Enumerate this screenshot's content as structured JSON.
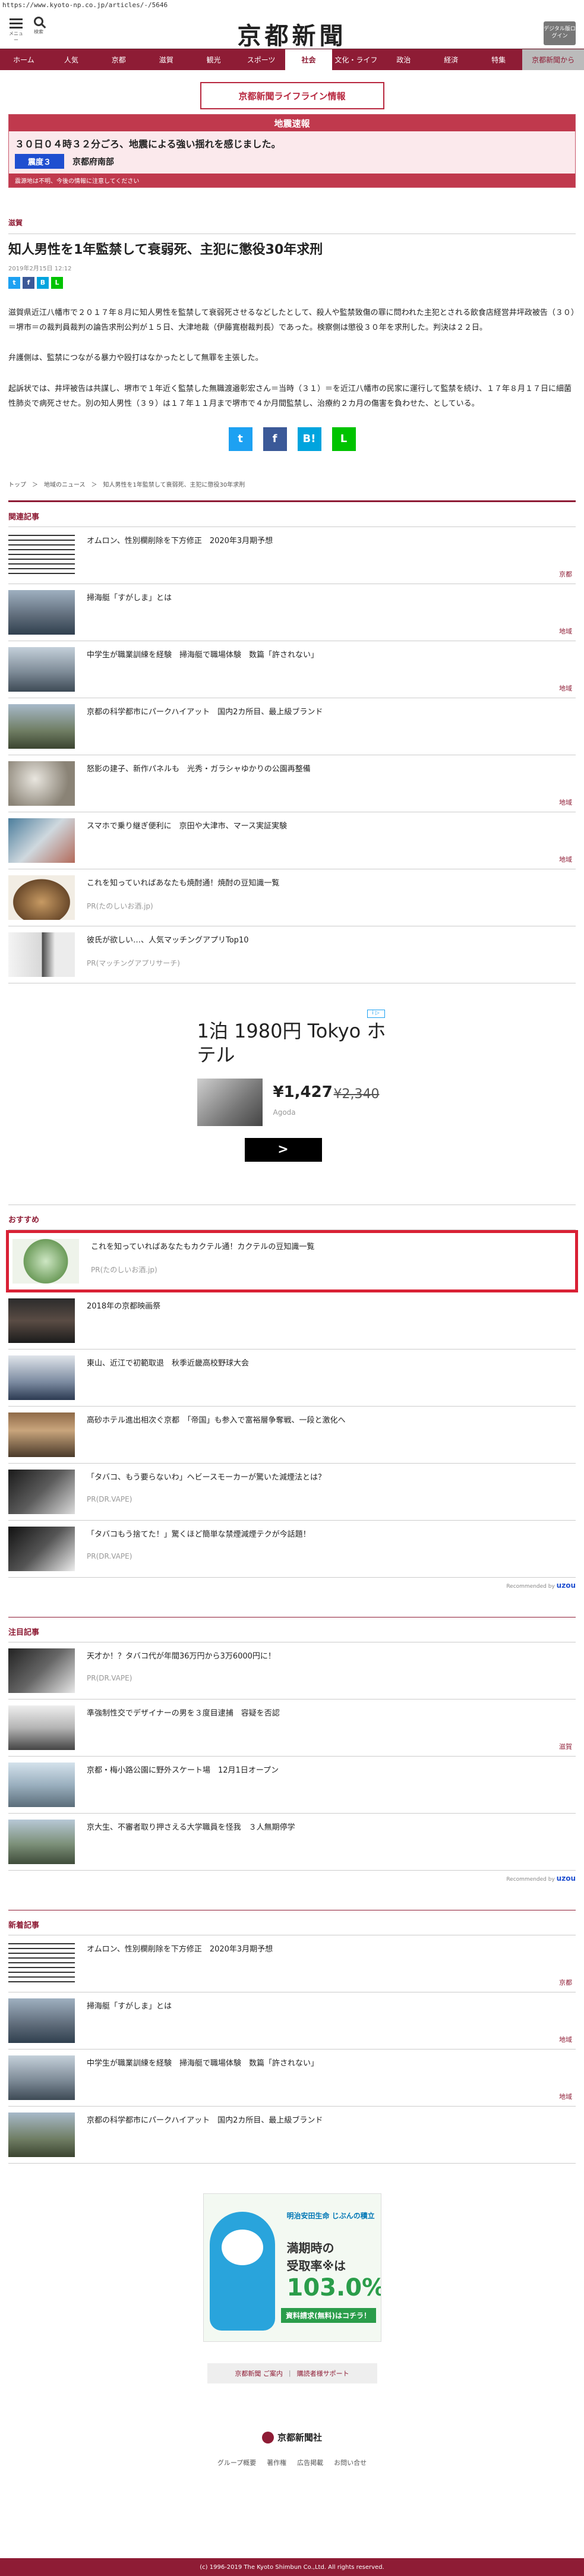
{
  "browser": {
    "url": "https://www.kyoto-np.co.jp/articles/-/5646"
  },
  "header": {
    "menu_label": "メニュー",
    "search_label": "検索",
    "logo": "京都新聞",
    "digital_label": "デジタル版ログイン"
  },
  "nav": {
    "items": [
      "ホーム",
      "人気",
      "京都",
      "滋賀",
      "観光",
      "スポーツ",
      "社会",
      "文化・ライフ",
      "政治",
      "経済",
      "特集"
    ],
    "active": "社会",
    "shinbun": "京都新聞から"
  },
  "lifeline": {
    "label": "京都新聞ライフライン情報"
  },
  "quake": {
    "header": "地震速報",
    "title": "３０日０４時３２分ごろ、地震による強い揺れを感じました。",
    "intensity": "震度３",
    "place": "京都府南部",
    "note": "震源地は不明、今後の情報に注意してください"
  },
  "article": {
    "category": "滋賀",
    "title": "知人男性を1年監禁して衰弱死、主犯に懲役30年求刑",
    "date": "2019年2月15日 12:12",
    "paragraphs": [
      "滋賀県近江八幡市で２０１７年８月に知人男性を監禁して衰弱死させるなどしたとして、殺人や監禁致傷の罪に問われた主犯とされる飲食店経営井坪政被告（３０）＝堺市＝の裁判員裁判の論告求刑公判が１５日、大津地裁（伊藤寛樹裁判長）であった。検察側は懲役３０年を求刑した。判決は２２日。",
      "弁護側は、監禁につながる暴力や殴打はなかったとして無罪を主張した。",
      "起訴状では、井坪被告は共謀し、堺市で１年近く監禁した無職渡邉彰宏さん＝当時（３１）＝を近江八幡市の民家に運行して監禁を続け、１７年８月１７日に細菌性肺炎で病死させた。別の知人男性（３９）は１７年１１月まで堺市で４か月間監禁し、治療約２カ月の傷害を負わせた、としている。"
    ]
  },
  "breadcrumb": [
    "トップ",
    "＞",
    "地域のニュース",
    "＞",
    "知人男性を1年監禁して衰弱死、主犯に懲役30年求刑"
  ],
  "related": {
    "heading": "関連記事",
    "items": [
      {
        "title": "オムロン、性別欄削除を下方修正　2020年3月期予想",
        "tag": "京都"
      },
      {
        "title": "掃海艇「すがしま」とは",
        "tag": "地域"
      },
      {
        "title": "中学生が職業訓練を経験　掃海艇で職場体験　数篇「許されない」",
        "tag": "地域"
      },
      {
        "title": "京都の科学都市にパークハイアット　国内2カ所目、最上級ブランド",
        "tag": ""
      },
      {
        "title": "怒影の建子、新作パネルも　光秀・ガラシャゆかりの公園再整備",
        "tag": "地域"
      },
      {
        "title": "スマホで乗り継ぎ便利に　京田や大津市、マース実証実験",
        "tag": "地域"
      }
    ],
    "pr_items": [
      {
        "title": "これを知っていればあなたも焼酎通！焼酎の豆知識一覧",
        "source": "PR(たのしいお酒.jp)"
      },
      {
        "title": "彼氏が欲しい…、人気マッチングアプリTop10",
        "source": "PR(マッチングアプリサーチ)"
      }
    ]
  },
  "ad": {
    "title": "1泊 1980円 Tokyo ホテル",
    "price": "¥1,427",
    "old_price": "¥2,340",
    "brand": "Agoda",
    "arrow": ">",
    "info": "i ▷"
  },
  "recommend": {
    "heading": "おすすめ",
    "items": [
      {
        "title": "これを知っていればあなたもカクテル通！カクテルの豆知識一覧",
        "source": "PR(たのしいお酒.jp)"
      },
      {
        "title": "2018年の京都映画祭",
        "source": ""
      },
      {
        "title": "東山、近江で初範取退　秋季近畿高校野球大会",
        "source": ""
      },
      {
        "title": "高砂ホテル進出相次ぐ京都　「帝国」も参入で富裕層争奪戦、一段と激化へ",
        "source": ""
      },
      {
        "title": "「タバコ、もう要らないわ」ヘビースモーカーが驚いた減煙法とは？",
        "source": "PR(DR.VAPE)"
      },
      {
        "title": "「タバコもう捨てた！」驚くほど簡単な禁煙減煙テクが今話題！",
        "source": "PR(DR.VAPE)"
      }
    ],
    "powered": "Recommended by",
    "powered_brand": "uzou"
  },
  "attention": {
    "heading": "注目記事",
    "items": [
      {
        "title": "天才か！？タバコ代が年間36万円から3万6000円に！",
        "source": "PR(DR.VAPE)",
        "tag": ""
      },
      {
        "title": "準強制性交でデザイナーの男を３度目逮捕　容疑を否認",
        "source": "",
        "tag": "滋賀"
      },
      {
        "title": "京都・梅小路公園に野外スケート場　12月1日オープン",
        "source": "",
        "tag": ""
      },
      {
        "title": "京大生、不審者取り押さえる大学職員を怪我　３人無期停学",
        "source": "",
        "tag": ""
      }
    ],
    "powered": "Recommended by",
    "powered_brand": "uzou"
  },
  "latest": {
    "heading": "新着記事",
    "items": [
      {
        "title": "オムロン、性別欄削除を下方修正　2020年3月期予想",
        "tag": "京都"
      },
      {
        "title": "掃海艇「すがしま」とは",
        "tag": "地域"
      },
      {
        "title": "中学生が職業訓練を経験　掃海艇で職場体験　数篇「許されない」",
        "tag": "地域"
      },
      {
        "title": "京都の科学都市にパークハイアット　国内2カ所目、最上級ブランド",
        "tag": ""
      }
    ]
  },
  "banner": {
    "line1": "明治安田生命 じぶんの積立",
    "line2": "満期時の",
    "line3": "受取率※は",
    "line4": "103.0%",
    "line5": "資料請求(無料)はコチラ！"
  },
  "footer": {
    "link1": "京都新聞 ご案内",
    "sep": "|",
    "link2": "購読者様サポート",
    "logo": "京都新聞社",
    "sub_links": [
      "グループ概要",
      "著作権",
      "広告掲載",
      "お問い合せ"
    ],
    "copyright": "(c) 1996-2019 The Kyoto Shimbun Co.,Ltd. All rights reserved."
  }
}
